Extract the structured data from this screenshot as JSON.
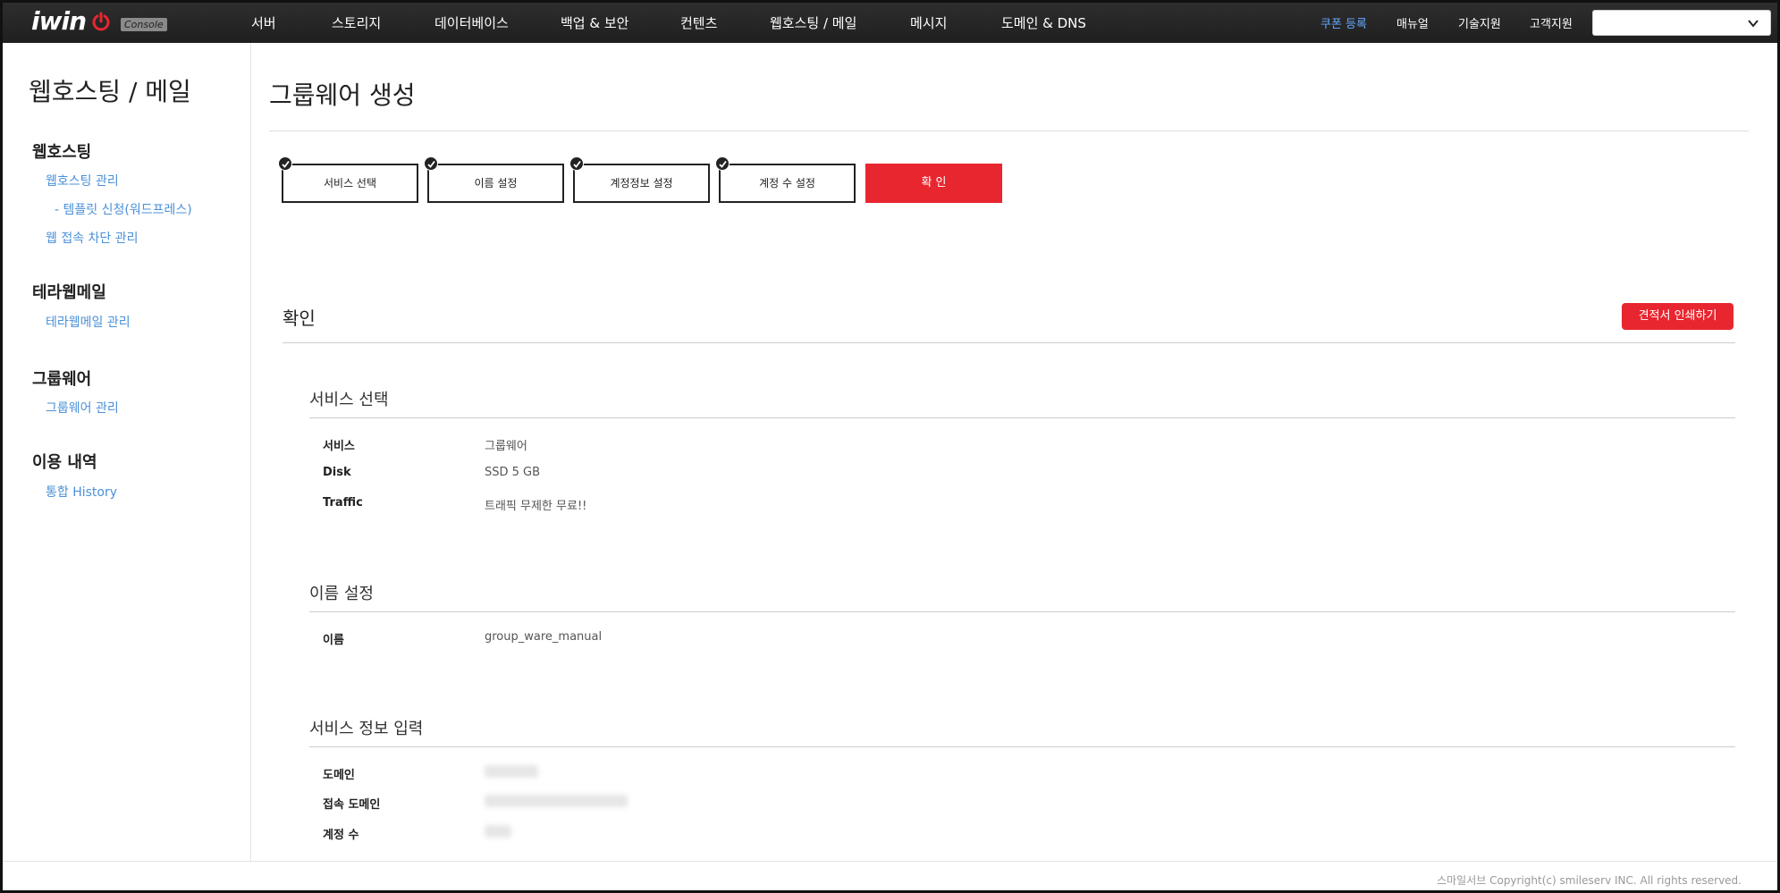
{
  "brand": {
    "logo_text": "iwin",
    "badge": "Console",
    "accent_color": "#e8262f",
    "link_color": "#4a90d9"
  },
  "topnav": {
    "items": [
      "서버",
      "스토리지",
      "데이터베이스",
      "백업 & 보안",
      "컨텐츠",
      "웹호스팅 / 메일",
      "메시지",
      "도메인 & DNS"
    ],
    "coupon": "쿠폰 등록",
    "manual": "매뉴얼",
    "tech_support": "기술지원",
    "customer_support": "고객지원",
    "project_select_value": ""
  },
  "sidebar": {
    "title": "웹호스팅 / 메일",
    "groups": [
      {
        "label": "웹호스팅",
        "links": [
          "웹호스팅 관리",
          "- 템플릿 신청(워드프레스)",
          "웹 접속 차단 관리"
        ]
      },
      {
        "label": "테라웹메일",
        "links": [
          "테라웹메일 관리"
        ]
      },
      {
        "label": "그룹웨어",
        "links": [
          "그룹웨어 관리"
        ]
      },
      {
        "label": "이용 내역",
        "links": [
          "통합 History"
        ]
      }
    ]
  },
  "page": {
    "title": "그룹웨어 생성",
    "steps": [
      "서비스 선택",
      "이름 설정",
      "계정정보 설정",
      "계정 수 설정"
    ],
    "confirm_step": "확 인"
  },
  "confirm": {
    "title": "확인",
    "print_button": "견적서 인쇄하기",
    "sections": [
      {
        "title": "서비스 선택",
        "rows": [
          {
            "label": "서비스",
            "value": "그룹웨어"
          },
          {
            "label": "Disk",
            "value": "SSD 5 GB"
          },
          {
            "label": "Traffic",
            "value": "트래픽 무제한 무료!!"
          }
        ]
      },
      {
        "title": "이름 설정",
        "rows": [
          {
            "label": "이름",
            "value": "group_ware_manual"
          }
        ]
      },
      {
        "title": "서비스 정보 입력",
        "rows": [
          {
            "label": "도메인",
            "value": ""
          },
          {
            "label": "접속 도메인",
            "value": ""
          },
          {
            "label": "계정 수",
            "value": ""
          }
        ]
      }
    ]
  },
  "footer": {
    "copyright": "스마일서브 Copyright(c) smileserv INC. All rights reserved."
  }
}
